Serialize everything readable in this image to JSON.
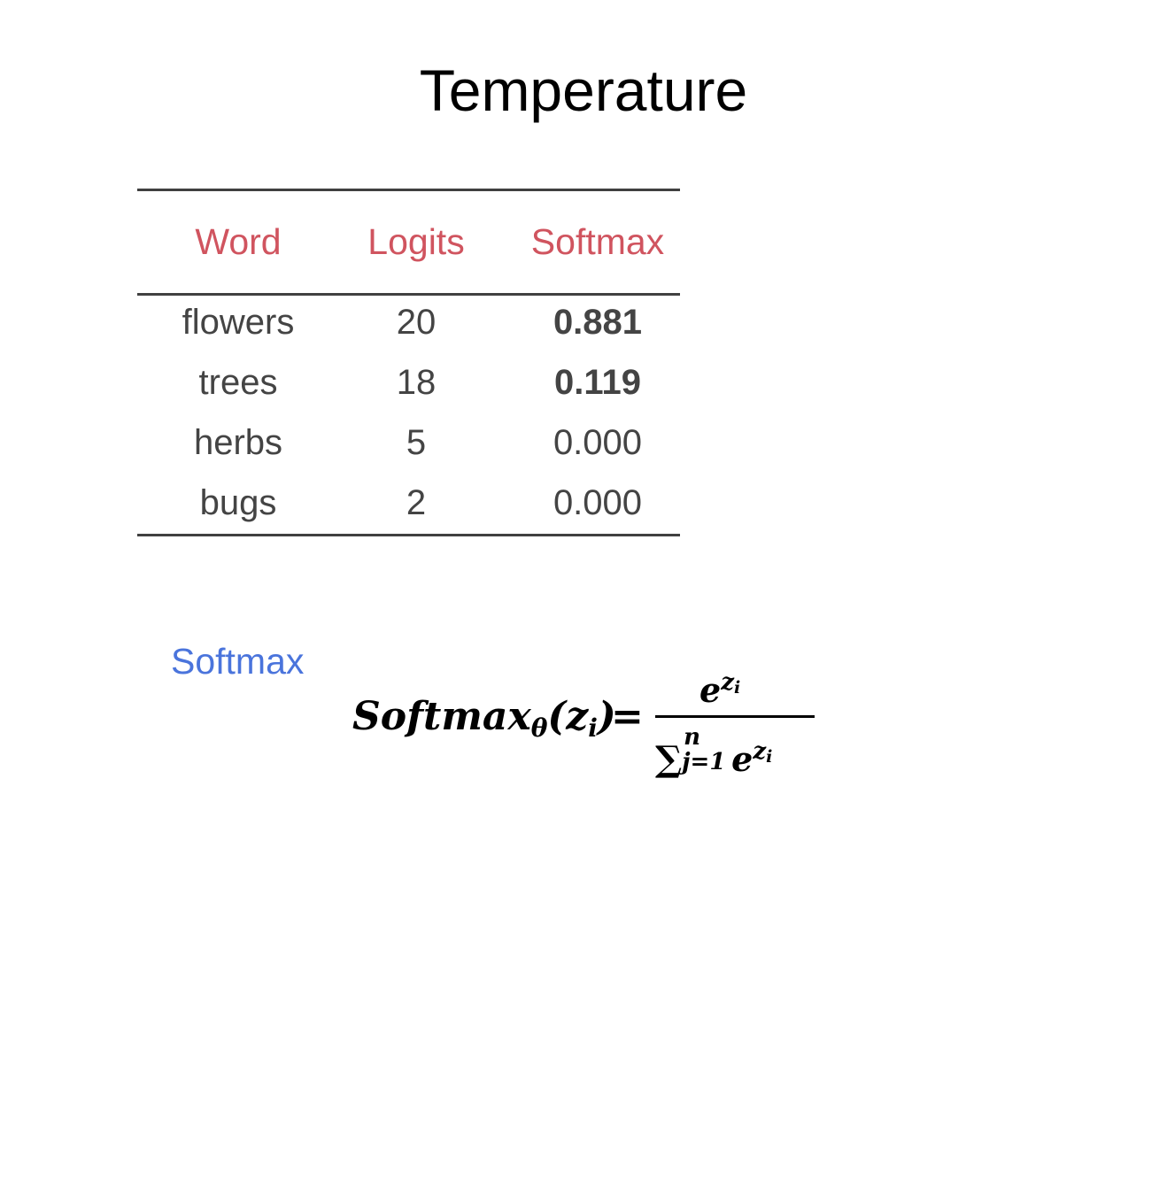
{
  "title": "Temperature",
  "table": {
    "headers": [
      "Word",
      "Logits",
      "Softmax"
    ],
    "rows": [
      {
        "word": "flowers",
        "logit": "20",
        "softmax": "0.881",
        "bold": true
      },
      {
        "word": "trees",
        "logit": "18",
        "softmax": "0.119",
        "bold": true
      },
      {
        "word": "herbs",
        "logit": "5",
        "softmax": "0.000",
        "bold": false
      },
      {
        "word": "bugs",
        "logit": "2",
        "softmax": "0.000",
        "bold": false
      }
    ]
  },
  "softmax_section": {
    "label": "Softmax",
    "formula": {
      "lhs": "Softmax",
      "lhs_subscript": "θ",
      "lhs_arg": "(z",
      "lhs_arg_subscript": "i",
      "lhs_close": ")",
      "equals": "=",
      "numerator_base": "e",
      "numerator_exp": "z",
      "numerator_exp_sub": "i",
      "sum_symbol": "∑",
      "sum_upper": "n",
      "sum_lower": "j=1",
      "denominator_base": "e",
      "denominator_exp": "z",
      "denominator_exp_sub": "i"
    }
  },
  "colors": {
    "header_text": "#d0545f",
    "section_label": "#4a74dc",
    "body_text": "#444444",
    "title_text": "#000000"
  }
}
